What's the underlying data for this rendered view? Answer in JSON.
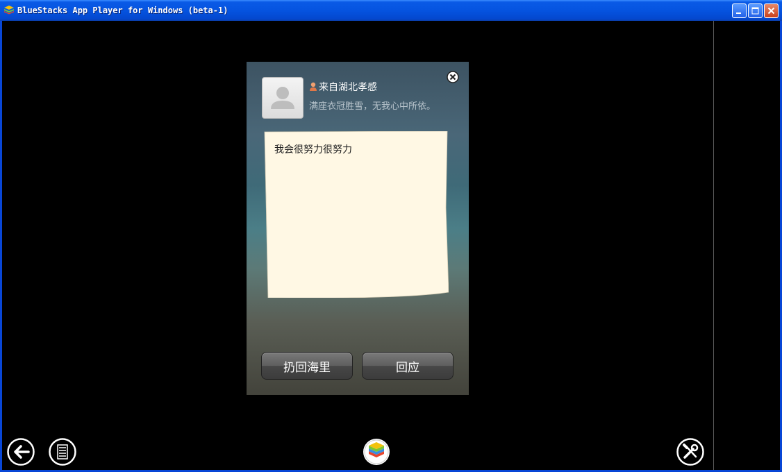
{
  "window": {
    "title": "BlueStacks App Player for Windows (beta-1)",
    "controls": [
      "minimize-icon",
      "maximize-icon",
      "close-icon"
    ],
    "colors": {
      "titlebar": "#0554e0",
      "close": "#c8401c"
    }
  },
  "popup": {
    "location": "来自湖北孝感",
    "signature": "满座衣冠胜雪，无我心中所依。",
    "message": "我会很努力很努力",
    "buttons": {
      "throw_back": "扔回海里",
      "reply": "回应"
    }
  },
  "taskbar": {
    "icons": [
      "back-arrow-icon",
      "menu-list-icon",
      "bluestacks-logo-icon",
      "settings-tools-icon"
    ]
  }
}
